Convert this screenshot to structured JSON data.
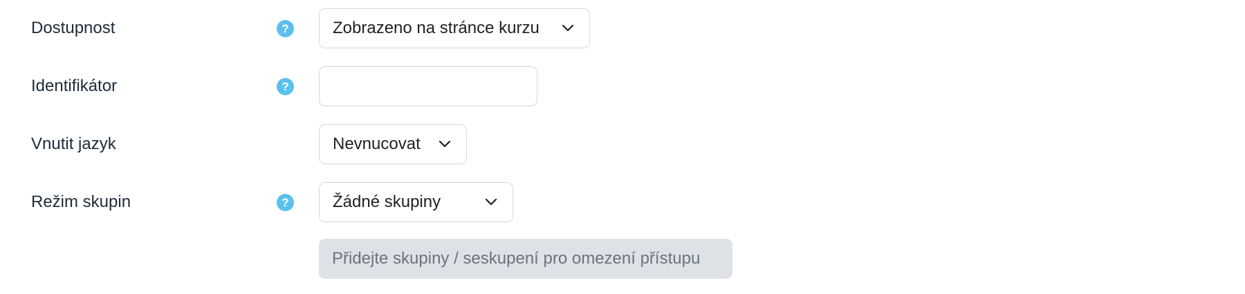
{
  "form": {
    "visibility": {
      "label": "Dostupnost",
      "help_icon": "question-circle-icon",
      "selected": "Zobrazeno na stránce kurzu"
    },
    "idnumber": {
      "label": "Identifikátor",
      "help_icon": "question-circle-icon",
      "value": ""
    },
    "lang": {
      "label": "Vnutit jazyk",
      "selected": "Nevnucovat"
    },
    "groupmode": {
      "label": "Režim skupin",
      "help_icon": "question-circle-icon",
      "selected": "Žádné skupiny"
    },
    "restrict_button": {
      "label": "Přidejte skupiny / seskupení pro omezení přístupu"
    },
    "colors": {
      "help_icon": "#5bc0eb",
      "label_text": "#1d2b3a",
      "field_border": "#d4d7db",
      "disabled_button_bg": "#dee2e6",
      "disabled_button_text": "#6a737b"
    }
  }
}
